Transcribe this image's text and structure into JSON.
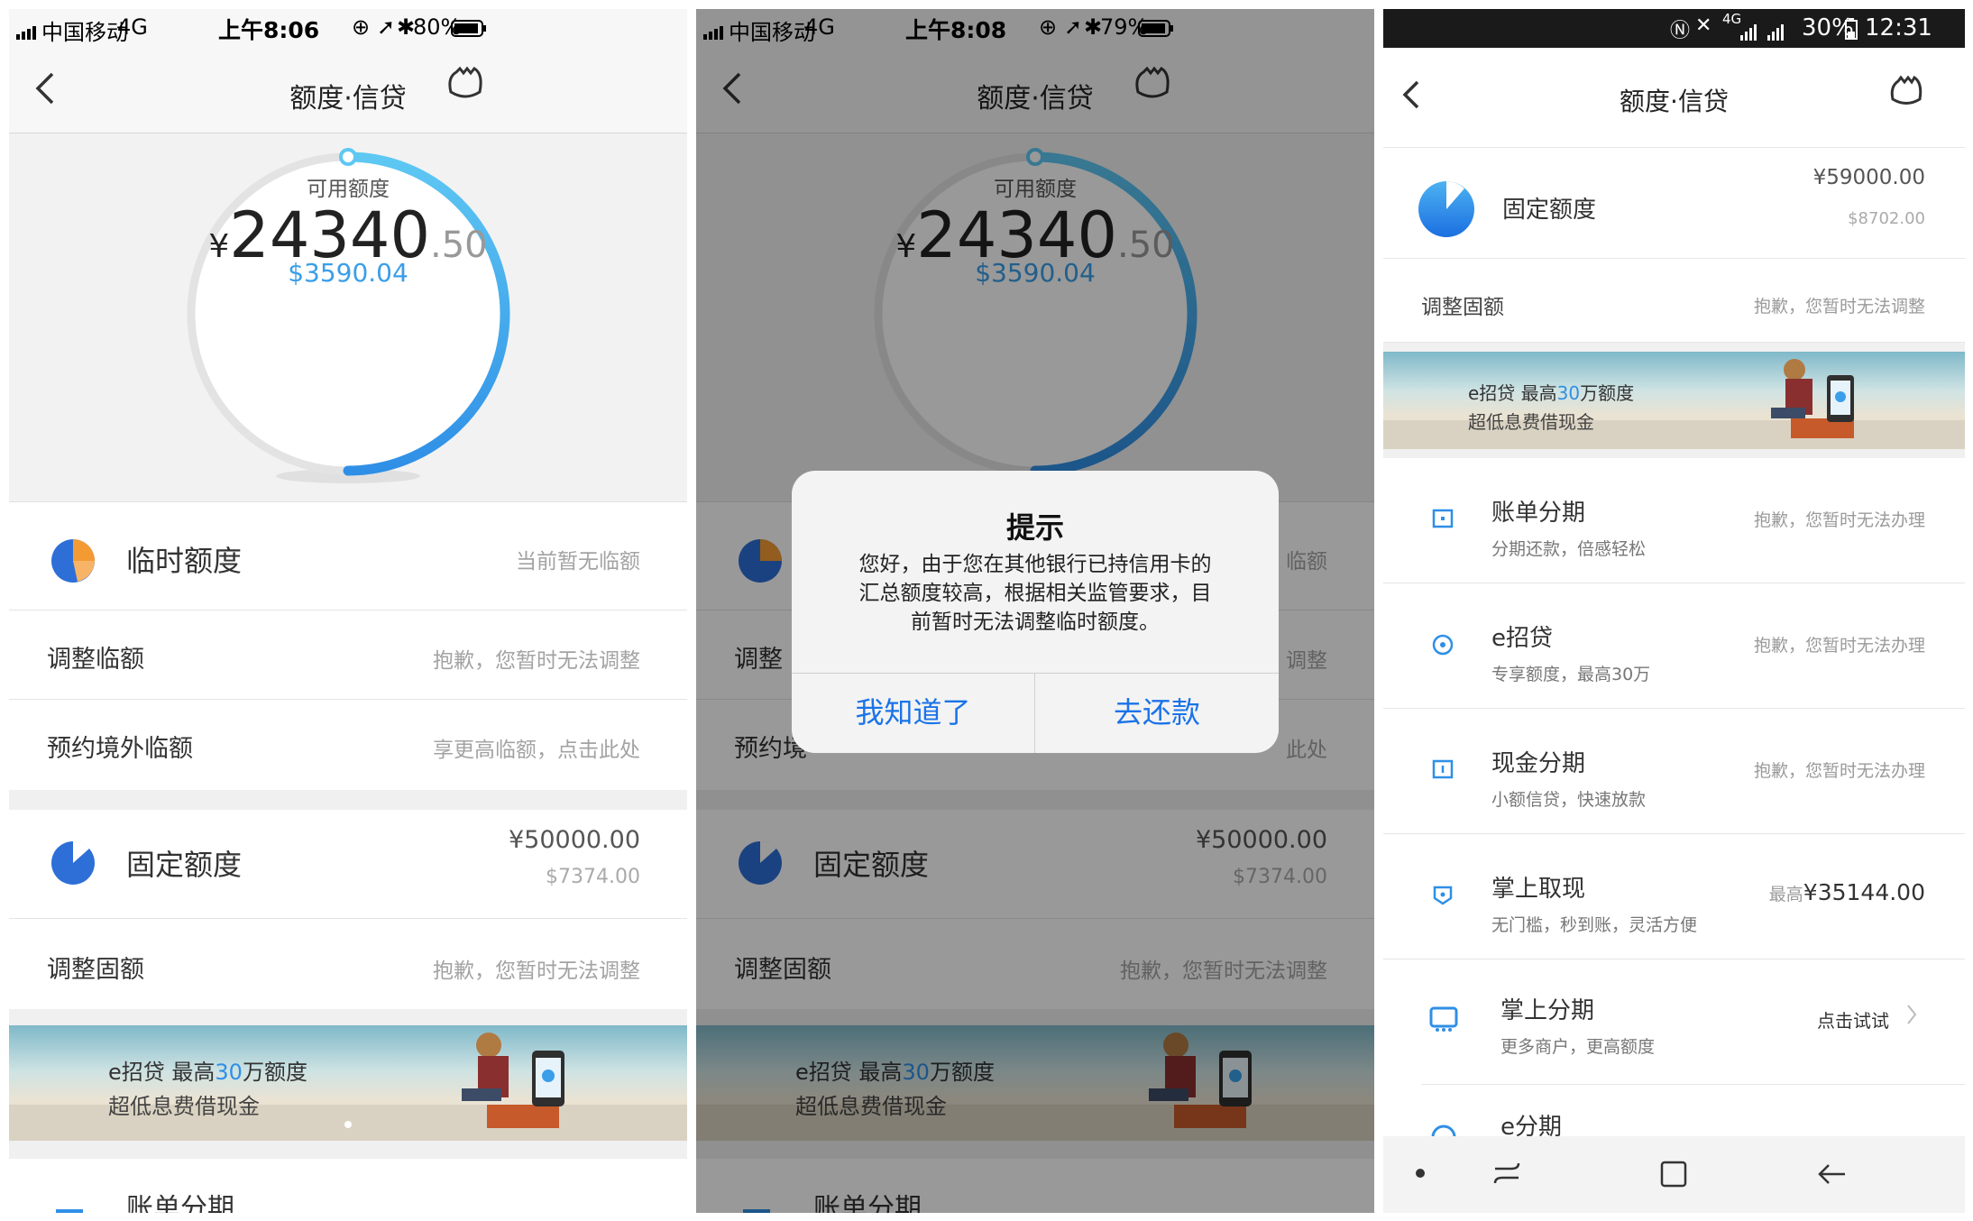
{
  "panel1": {
    "status": {
      "carrier": "中国移动",
      "network": "4G",
      "time": "上午8:06",
      "battery": "80%"
    },
    "nav": {
      "title": "额度·信贷"
    },
    "gauge": {
      "label": "可用额度",
      "currency": "¥",
      "amount_int": "24340",
      "amount_dec": ".50",
      "usd": "$3590.04",
      "fill_fraction": 0.49
    },
    "temp": {
      "label": "临时额度",
      "hint": "当前暂无临额"
    },
    "adjust_temp": {
      "label": "调整临额",
      "hint": "抱歉，您暂时无法调整"
    },
    "overseas": {
      "label": "预约境外临额",
      "hint": "享更高临额，点击此处"
    },
    "fixed": {
      "label": "固定额度",
      "cny": "¥50000.00",
      "usd": "$7374.00"
    },
    "adjust_fixed": {
      "label": "调整固额",
      "hint": "抱歉，您暂时无法调整"
    },
    "banner": {
      "line1_a": "e招贷  最高",
      "line1_b": "30",
      "line1_c": "万额度",
      "line2": "超低息费借现金"
    },
    "bill": {
      "label": "账单分期"
    }
  },
  "panel2": {
    "status": {
      "carrier": "中国移动",
      "network": "4G",
      "time": "上午8:08",
      "battery": "79%"
    },
    "nav": {
      "title": "额度·信贷"
    },
    "gauge": {
      "label": "可用额度",
      "currency": "¥",
      "amount_int": "24340",
      "amount_dec": ".50",
      "usd": "$3590.04"
    },
    "temp": {
      "label": "临",
      "hint": "临额"
    },
    "adjust_temp": {
      "label": "调整",
      "hint": "调整"
    },
    "overseas": {
      "label": "预约境",
      "hint": "此处"
    },
    "fixed": {
      "label": "固定额度",
      "cny": "¥50000.00",
      "usd": "$7374.00"
    },
    "adjust_fixed": {
      "label": "调整固额",
      "hint": "抱歉，您暂时无法调整"
    },
    "banner": {
      "line1_a": "e招贷  最高",
      "line1_b": "30",
      "line1_c": "万额度",
      "line2": "超低息费借现金"
    },
    "bill": {
      "label": "账单分期"
    },
    "alert": {
      "title": "提示",
      "line1": "您好，由于您在其他银行已持信用卡的",
      "line2": "汇总额度较高，根据相关监管要求，目",
      "line3": "前暂时无法调整临时额度。",
      "btn_ok": "我知道了",
      "btn_repay": "去还款"
    }
  },
  "panel3": {
    "status": {
      "signal": "4G",
      "battery": "30%",
      "time": "12:31"
    },
    "nav": {
      "title": "额度·信贷"
    },
    "fixed": {
      "label": "固定额度",
      "cny": "¥59000.00",
      "usd": "$8702.00"
    },
    "adjust_fixed": {
      "label": "调整固额",
      "hint": "抱歉，您暂时无法调整"
    },
    "banner": {
      "line1_a": "e招贷  最高",
      "line1_b": "30",
      "line1_c": "万额度",
      "line2": "超低息费借现金"
    },
    "items": [
      {
        "title": "账单分期",
        "sub": "分期还款，倍感轻松",
        "hint": "抱歉，您暂时无法办理"
      },
      {
        "title": "e招贷",
        "sub": "专享额度，最高30万",
        "hint": "抱歉，您暂时无法办理"
      },
      {
        "title": "现金分期",
        "sub": "小额信贷，快速放款",
        "hint": "抱歉，您暂时无法办理"
      },
      {
        "title": "掌上取现",
        "sub": "无门槛，秒到账，灵活方便",
        "hint_small": "最高",
        "hint_amount": "¥35144.00"
      },
      {
        "title": "掌上分期",
        "sub": "更多商户，更高额度",
        "hint": "点击试试"
      },
      {
        "title": "e分期"
      }
    ]
  },
  "colors": {
    "accent": "#2f8fe6",
    "accent_light": "#5ec8f3",
    "orange": "#f39b32",
    "blue_pie": "#2d6fd6"
  }
}
